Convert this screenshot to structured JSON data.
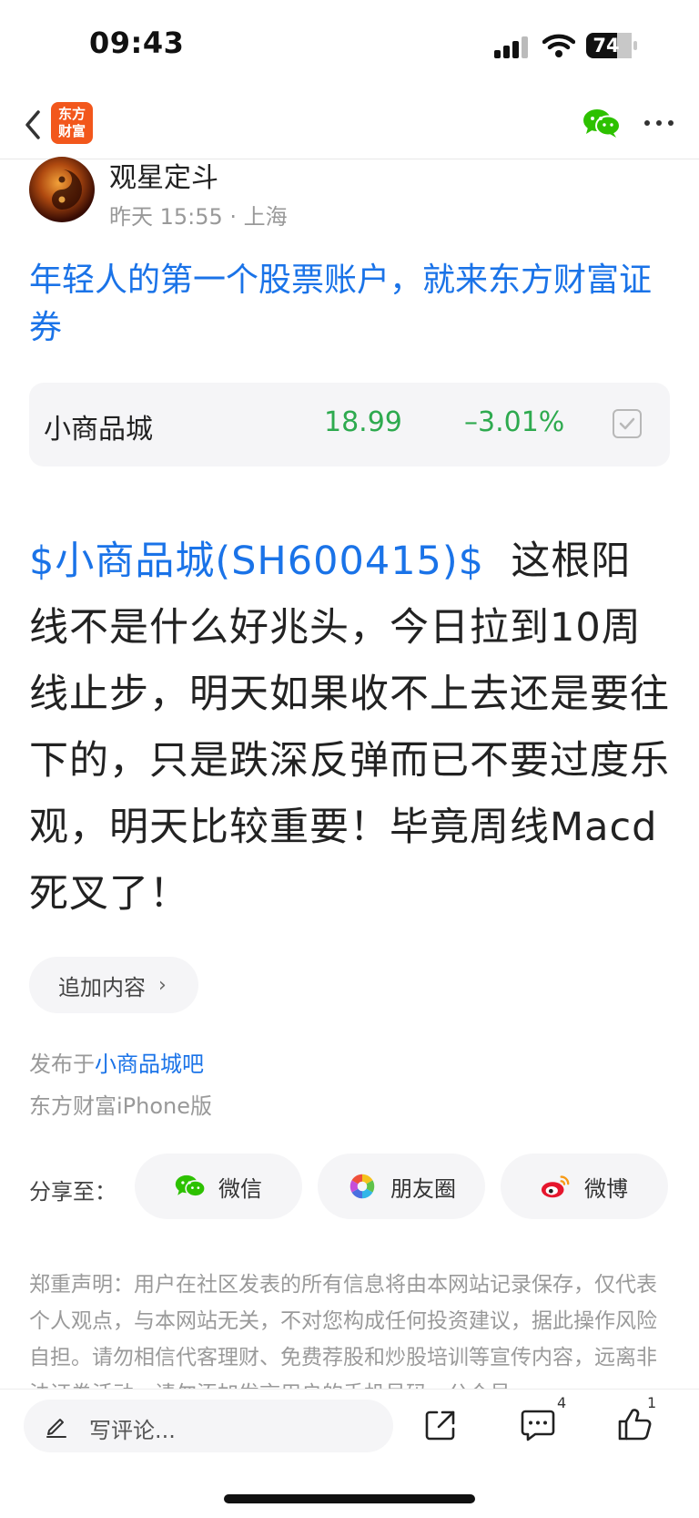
{
  "status_bar": {
    "time": "09:43",
    "battery": "74"
  },
  "header": {
    "logo_line1": "东方",
    "logo_line2": "财富",
    "colors": {
      "logo_bg": "#f2571c",
      "wechat_green": "#2dc100"
    }
  },
  "post": {
    "author": "观星定斗",
    "meta": "昨天 15:55 · 上海",
    "promo_text": "年轻人的第一个股票账户，就来东方财富证券",
    "stock_card": {
      "name": "小商品城",
      "price": "18.99",
      "change": "–3.01%"
    },
    "stock_link": "$小商品城(SH600415)$",
    "body_text": "这根阳线不是什么好兆头，今日拉到10周线止步，明天如果收不上去还是要往下的，只是跌深反弹而已不要过度乐观，明天比较重要！毕竟周线Macd死叉了！",
    "append_label": "追加内容",
    "publish_prefix": "发布于",
    "forum": "小商品城吧",
    "client": "东方财富iPhone版"
  },
  "share": {
    "label": "分享至：",
    "wechat": "微信",
    "moments": "朋友圈",
    "weibo": "微博"
  },
  "disclaimer": "郑重声明：用户在社区发表的所有信息将由本网站记录保存，仅代表个人观点，与本网站无关，不对您构成任何投资建议，据此操作风险自担。请勿相信代客理财、免费荐股和炒股培训等宣传内容，远离非法证券活动。请勿添加发言用户的手机号码、公众号",
  "bottom_bar": {
    "comment_placeholder": "写评论...",
    "comment_count": "4",
    "like_count": "1"
  }
}
